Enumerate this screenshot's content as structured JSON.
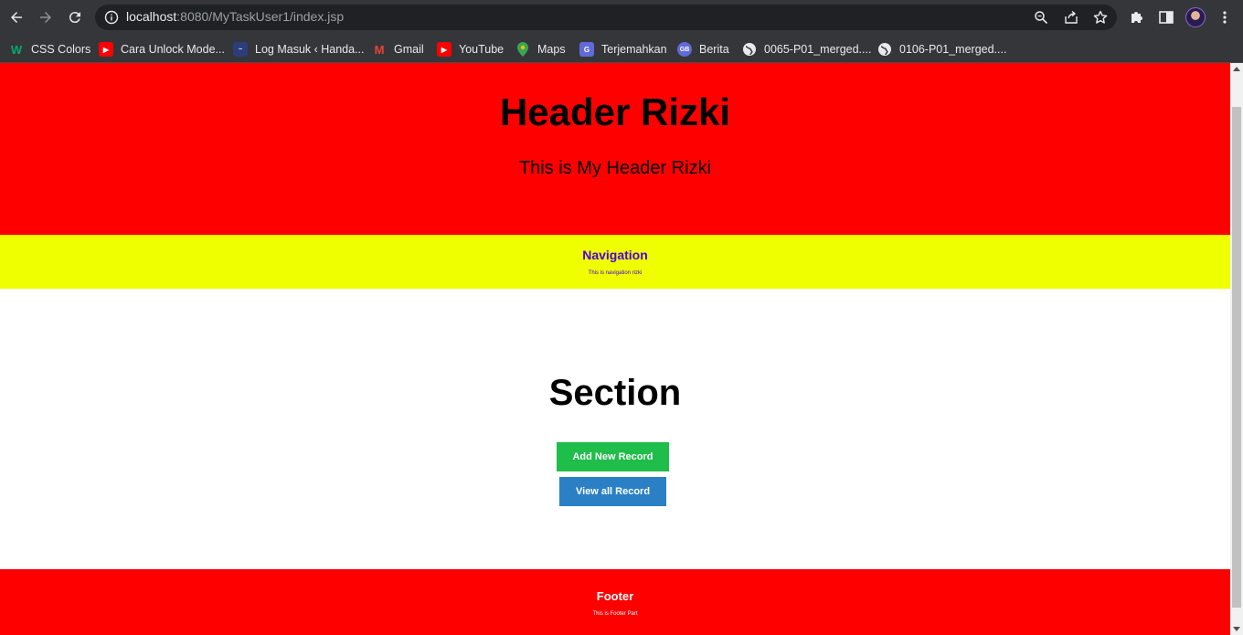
{
  "browser": {
    "url_host": "localhost",
    "url_rest": ":8080/MyTaskUser1/index.jsp",
    "bookmarks": [
      {
        "label": "CSS Colors",
        "icon": "w3-icon",
        "color": "#04aa6d"
      },
      {
        "label": "Cara Unlock Mode...",
        "icon": "youtube-icon",
        "color": "#ff0000"
      },
      {
        "label": "Log Masuk ‹ Handa...",
        "icon": "site-icon",
        "color": "#2c3e7a"
      },
      {
        "label": "Gmail",
        "icon": "gmail-icon",
        "color": "#ea4335"
      },
      {
        "label": "YouTube",
        "icon": "youtube-icon",
        "color": "#ff0000"
      },
      {
        "label": "Maps",
        "icon": "maps-icon",
        "color": "#34a853"
      },
      {
        "label": "Terjemahkan",
        "icon": "translate-icon",
        "color": "#8ab4f8"
      },
      {
        "label": "Berita",
        "icon": "news-icon",
        "color": "#8ab4f8"
      },
      {
        "label": "0065-P01_merged....",
        "icon": "globe-icon",
        "color": "#e8eaed"
      },
      {
        "label": "0106-P01_merged....",
        "icon": "globe-icon",
        "color": "#e8eaed"
      }
    ]
  },
  "page": {
    "header": {
      "title": "Header Rizki",
      "subtitle": "This is My Header Rizki",
      "bg": "#ff0000"
    },
    "nav": {
      "title": "Navigation",
      "text": "This is navigation rizki",
      "bg": "#f0ff00",
      "color": "#4b00e0"
    },
    "section": {
      "title": "Section",
      "add_label": "Add New Record",
      "view_label": "View all Record",
      "add_color": "#1fbd4a",
      "view_color": "#2b80c5"
    },
    "footer": {
      "title": "Footer",
      "text": "This is Footer Part",
      "bg": "#ff0000"
    }
  }
}
